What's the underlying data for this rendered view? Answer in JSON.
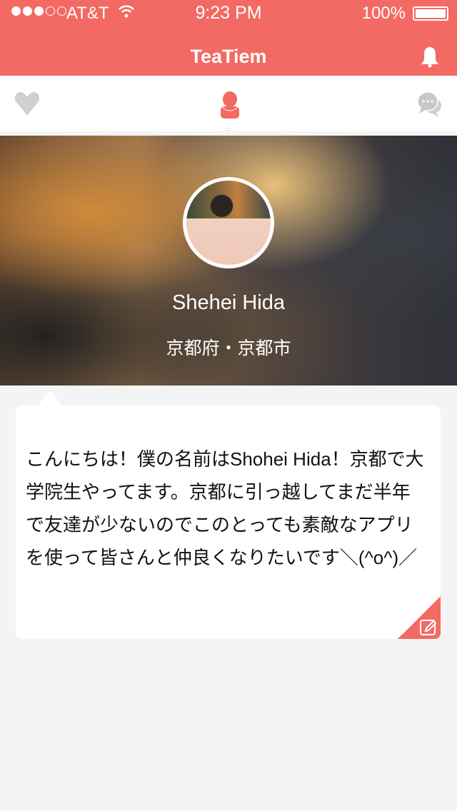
{
  "status": {
    "carrier": "AT&T",
    "time": "9:23 PM",
    "battery": "100%",
    "signal_bars": 3,
    "signal_total": 5
  },
  "header": {
    "title": "TeaTiem"
  },
  "tabs": [
    {
      "name": "likes",
      "icon": "heart-icon"
    },
    {
      "name": "profile",
      "icon": "person-icon",
      "active": true
    },
    {
      "name": "messages",
      "icon": "chat-icon"
    }
  ],
  "profile": {
    "name": "Shehei Hida",
    "location": "京都府・京都市",
    "bio": "こんにちは！僕の名前はShohei Hida！京都で大学院生やってます。京都に引っ越してまだ半年で友達が少ないのでこのとっても素敵なアプリを使って皆さんと仲良くなりたいです＼(^o^)／"
  },
  "colors": {
    "accent": "#f26a63",
    "inactive_icon": "#cccccc"
  }
}
